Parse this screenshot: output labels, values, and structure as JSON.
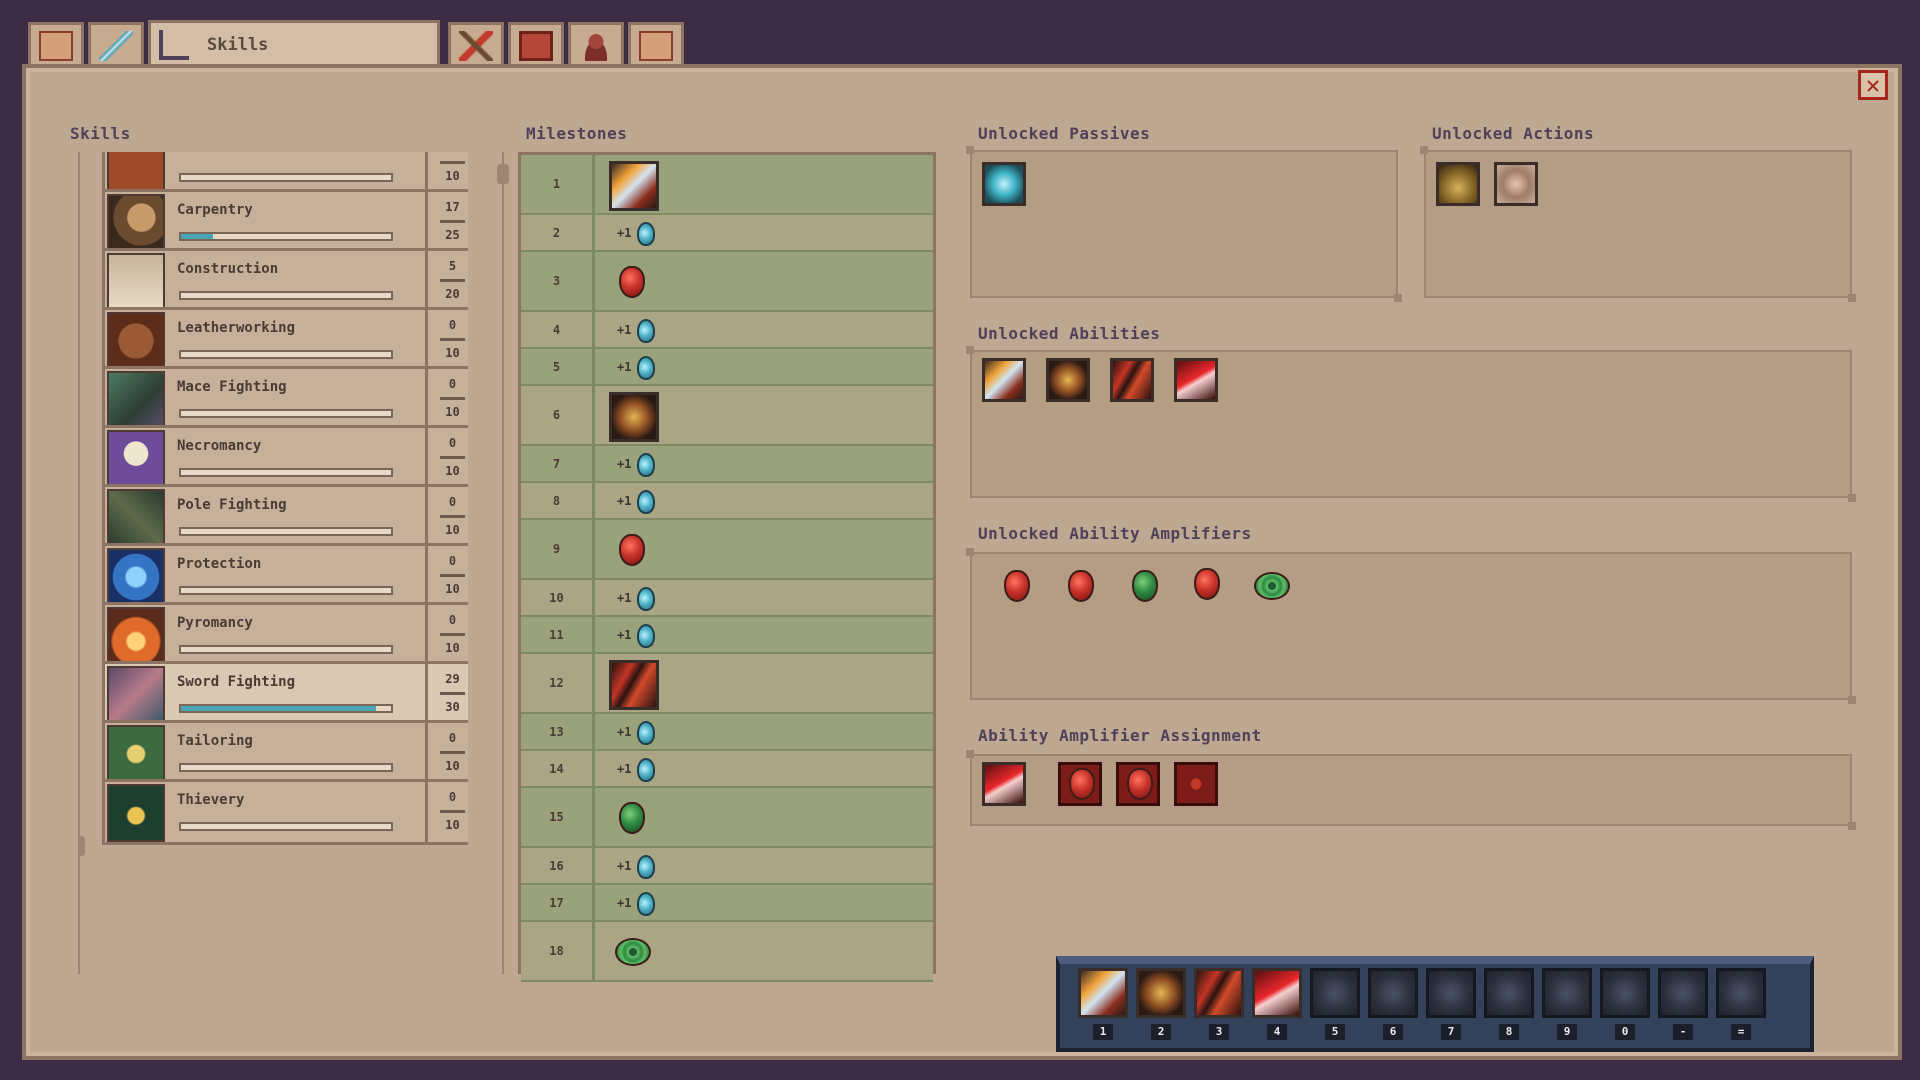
{
  "tabs": [
    {
      "icon": "map-icon"
    },
    {
      "icon": "sword-icon"
    },
    {
      "icon": "skill-tree-icon",
      "label": "Skills",
      "active": true
    },
    {
      "icon": "pickaxe-icon"
    },
    {
      "icon": "journal-icon"
    },
    {
      "icon": "character-icon"
    },
    {
      "icon": "map-icon"
    }
  ],
  "headers": {
    "skills": "Skills",
    "milestones": "Milestones",
    "unlocked_passives": "Unlocked Passives",
    "unlocked_actions": "Unlocked Actions",
    "unlocked_abilities": "Unlocked Abilities",
    "unlocked_amplifiers": "Unlocked Ability Amplifiers",
    "amplifier_assignment": "Ability Amplifier Assignment"
  },
  "skills": [
    {
      "name": "",
      "current": "",
      "max": "10",
      "progress": 0,
      "icon": "partial-skill-icon"
    },
    {
      "name": "Carpentry",
      "current": "17",
      "max": "25",
      "progress": 0.15,
      "icon": "saw-icon"
    },
    {
      "name": "Construction",
      "current": "5",
      "max": "20",
      "progress": 0,
      "icon": "blueprint-icon"
    },
    {
      "name": "Leatherworking",
      "current": "0",
      "max": "10",
      "progress": 0,
      "icon": "leather-icon"
    },
    {
      "name": "Mace Fighting",
      "current": "0",
      "max": "10",
      "progress": 0,
      "icon": "mace-icon"
    },
    {
      "name": "Necromancy",
      "current": "0",
      "max": "10",
      "progress": 0,
      "icon": "skull-icon"
    },
    {
      "name": "Pole Fighting",
      "current": "0",
      "max": "10",
      "progress": 0,
      "icon": "spear-icon"
    },
    {
      "name": "Protection",
      "current": "0",
      "max": "10",
      "progress": 0,
      "icon": "shield-icon"
    },
    {
      "name": "Pyromancy",
      "current": "0",
      "max": "10",
      "progress": 0,
      "icon": "fire-hand-icon"
    },
    {
      "name": "Sword Fighting",
      "current": "29",
      "max": "30",
      "progress": 0.93,
      "icon": "crossed-swords-icon",
      "selected": true
    },
    {
      "name": "Tailoring",
      "current": "0",
      "max": "10",
      "progress": 0,
      "icon": "thread-icon"
    },
    {
      "name": "Thievery",
      "current": "0",
      "max": "10",
      "progress": 0,
      "icon": "steal-hand-icon"
    }
  ],
  "milestones": [
    {
      "level": "1",
      "reward": "ability",
      "icon": "sword-strike-icon"
    },
    {
      "level": "2",
      "reward": "potion",
      "plus": "+1"
    },
    {
      "level": "3",
      "reward": "amplifier",
      "icon": "red-gem-icon"
    },
    {
      "level": "4",
      "reward": "potion",
      "plus": "+1"
    },
    {
      "level": "5",
      "reward": "potion",
      "plus": "+1"
    },
    {
      "level": "6",
      "reward": "ability",
      "icon": "shadow-dash-icon"
    },
    {
      "level": "7",
      "reward": "potion",
      "plus": "+1"
    },
    {
      "level": "8",
      "reward": "potion",
      "plus": "+1"
    },
    {
      "level": "9",
      "reward": "amplifier",
      "icon": "red-gem-icon"
    },
    {
      "level": "10",
      "reward": "potion",
      "plus": "+1"
    },
    {
      "level": "11",
      "reward": "potion",
      "plus": "+1"
    },
    {
      "level": "12",
      "reward": "ability",
      "icon": "claw-slash-icon"
    },
    {
      "level": "13",
      "reward": "potion",
      "plus": "+1"
    },
    {
      "level": "14",
      "reward": "potion",
      "plus": "+1"
    },
    {
      "level": "15",
      "reward": "amplifier",
      "icon": "green-gem-icon"
    },
    {
      "level": "16",
      "reward": "potion",
      "plus": "+1"
    },
    {
      "level": "17",
      "reward": "potion",
      "plus": "+1"
    },
    {
      "level": "18",
      "reward": "amplifier",
      "icon": "green-ring-gem-icon"
    }
  ],
  "passives": [
    {
      "icon": "crossed-blades-passive-icon"
    }
  ],
  "actions": [
    {
      "icon": "pouch-icon"
    },
    {
      "icon": "open-hand-icon"
    }
  ],
  "abilities": [
    {
      "icon": "sword-strike-icon"
    },
    {
      "icon": "shadow-dash-icon"
    },
    {
      "icon": "claw-slash-icon"
    },
    {
      "icon": "crimson-slash-icon"
    }
  ],
  "amplifiers": [
    {
      "icon": "red-gem-icon",
      "color": "red"
    },
    {
      "icon": "red-gem-icon",
      "color": "red"
    },
    {
      "icon": "green-gem-icon",
      "color": "green"
    },
    {
      "icon": "red-gem-icon",
      "color": "red"
    },
    {
      "icon": "green-ring-gem-icon",
      "color": "green"
    }
  ],
  "assignment": [
    {
      "icon": "crimson-slash-icon"
    },
    {
      "icon": "red-gem-slot-icon"
    },
    {
      "icon": "red-gem-slot-icon"
    },
    {
      "icon": "empty-amplifier-slot-icon"
    }
  ],
  "hotbar": {
    "slots": [
      {
        "key": "1",
        "icon": "sword-strike-icon"
      },
      {
        "key": "2",
        "icon": "shadow-dash-icon"
      },
      {
        "key": "3",
        "icon": "claw-slash-icon"
      },
      {
        "key": "4",
        "icon": "crimson-slash-icon"
      },
      {
        "key": "5",
        "icon": "empty-slot-icon"
      },
      {
        "key": "6",
        "icon": "empty-slot-icon"
      },
      {
        "key": "7",
        "icon": "empty-slot-icon"
      },
      {
        "key": "8",
        "icon": "empty-slot-icon"
      },
      {
        "key": "9",
        "icon": "empty-slot-icon"
      },
      {
        "key": "0",
        "icon": "empty-slot-icon"
      },
      {
        "key": "-",
        "icon": "empty-slot-icon"
      },
      {
        "key": "=",
        "icon": "empty-slot-icon"
      }
    ]
  },
  "colors": {
    "background": "#3d2c45",
    "parchment": "#bfa891",
    "milestone_green": "#9aa27b",
    "progress": "#4aa6b3",
    "close_red": "#a3251c"
  }
}
